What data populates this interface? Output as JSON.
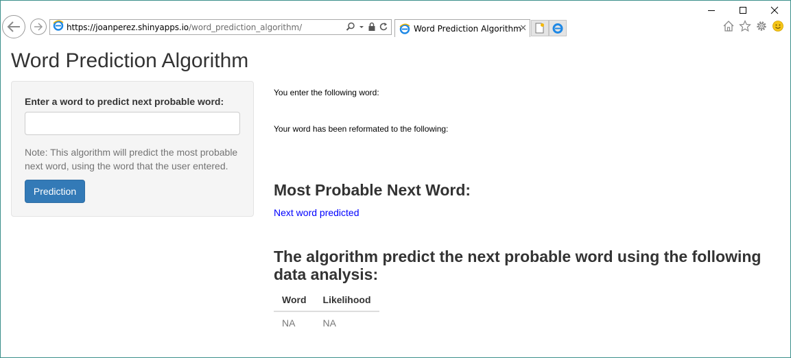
{
  "browser": {
    "url_prefix": "https://",
    "url_domain": "joanperez.shinyapps.io",
    "url_path": "/word_prediction_algorithm/",
    "tab_title": "Word Prediction Algorithm",
    "tab_close": "✕"
  },
  "page": {
    "title": "Word Prediction Algorithm"
  },
  "sidebar": {
    "input_label": "Enter a word to predict next probable word:",
    "input_value": "",
    "note": "Note: This algorithm will predict the most probable next word, using the word that the user entered.",
    "button_label": "Prediction"
  },
  "main": {
    "entered_label": "You enter the following word:",
    "reformatted_label": "Your word has been reformated to the following:",
    "next_word_heading": "Most Probable Next Word:",
    "next_word_value": "Next word predicted",
    "analysis_heading": "The algorithm predict the next probable word using the following data analysis:",
    "table": {
      "headers": [
        "Word",
        "Likelihood"
      ],
      "rows": [
        [
          "NA",
          "NA"
        ]
      ]
    }
  },
  "colors": {
    "primary_button": "#337ab7",
    "link": "#0000ff",
    "well_bg": "#f5f5f5"
  }
}
